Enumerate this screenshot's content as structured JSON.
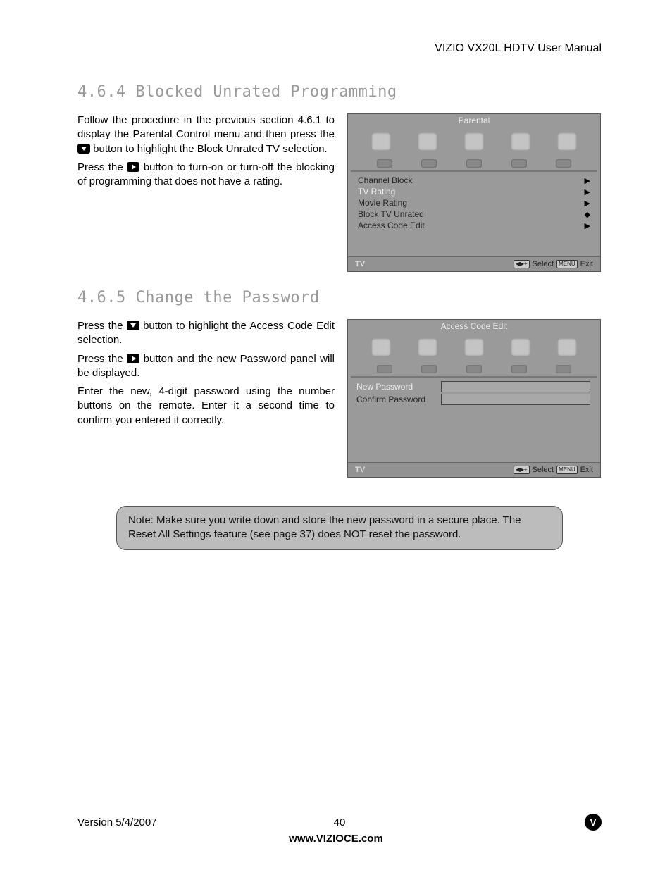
{
  "header": {
    "manual_title": "VIZIO VX20L HDTV User Manual"
  },
  "section1": {
    "heading": "4.6.4 Blocked Unrated Programming",
    "p1_a": "Follow the procedure in the previous section 4.6.1 to display the Parental Control menu and then press the ",
    "p1_b": " button to highlight the Block Unrated TV selection.",
    "p2_a": "Press the ",
    "p2_b": " button to turn-on or turn-off the blocking of programming that does not have a rating.",
    "osd": {
      "title": "Parental",
      "items": [
        {
          "label": "Channel Block",
          "arrow": "▶",
          "selected": false
        },
        {
          "label": "TV Rating",
          "arrow": "▶",
          "selected": true
        },
        {
          "label": "Movie Rating",
          "arrow": "▶",
          "selected": false
        },
        {
          "label": "Block TV Unrated",
          "arrow": "◆",
          "selected": false
        },
        {
          "label": "Access Code Edit",
          "arrow": "▶",
          "selected": false
        }
      ],
      "footer_left": "TV",
      "footer_key1": "◀▶÷",
      "footer_select": "Select",
      "footer_key2": "MENU",
      "footer_exit": "Exit"
    }
  },
  "section2": {
    "heading": "4.6.5 Change the Password",
    "p1_a": "Press the ",
    "p1_b": " button to highlight the Access Code Edit selection.",
    "p2_a": "Press the ",
    "p2_b": " button and the new Password panel will be displayed.",
    "p3": "Enter the new, 4-digit password using the number buttons on the remote.  Enter it a second time to confirm you entered it correctly.",
    "osd": {
      "title": "Access Code Edit",
      "rows": [
        {
          "label": "New Password",
          "selected": true
        },
        {
          "label": "Confirm Password",
          "selected": false
        }
      ],
      "footer_left": "TV",
      "footer_key1": "◀▶÷",
      "footer_select": "Select",
      "footer_key2": "MENU",
      "footer_exit": "Exit"
    }
  },
  "note": {
    "text": "Note: Make sure you write down and store the new password in a secure place. The Reset All Settings feature (see page 37) does NOT reset the password."
  },
  "footer": {
    "version": "Version 5/4/2007",
    "page": "40",
    "url": "www.VIZIOCE.com",
    "badge": "V"
  }
}
